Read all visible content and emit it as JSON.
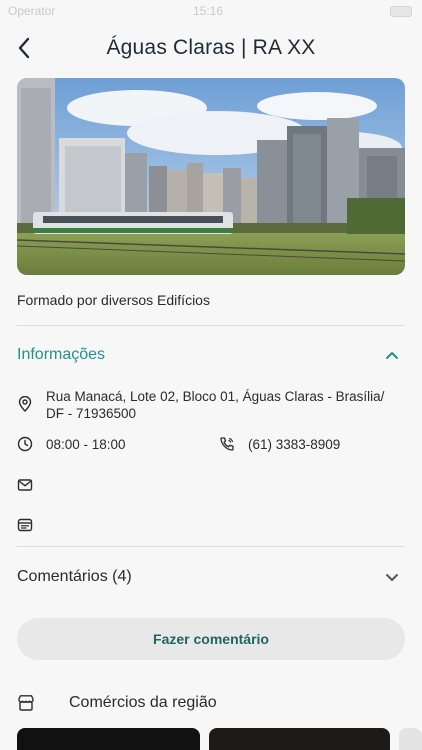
{
  "status_bar": {
    "carrier": "Operator",
    "time": "15:16"
  },
  "header": {
    "title": "Águas Claras | RA XX",
    "back_icon": "chevron-left-icon"
  },
  "place": {
    "description": "Formado por diversos Edifícios"
  },
  "info_section": {
    "title": "Informações",
    "address": "Rua Manacá, Lote 02, Bloco 01, Águas Claras - Brasília/ DF - 71936500",
    "hours": "08:00 - 18:00",
    "phone": "(61) 3383-8909",
    "email": "",
    "website": ""
  },
  "comments_section": {
    "title": "Comentários (4)"
  },
  "actions": {
    "comment_button": "Fazer comentário"
  },
  "shops_section": {
    "title": "Comércios da região"
  },
  "colors": {
    "accent": "#22918a",
    "button_text": "#1e6661",
    "title_text": "#1f2b36",
    "background": "#f7f7f7"
  }
}
